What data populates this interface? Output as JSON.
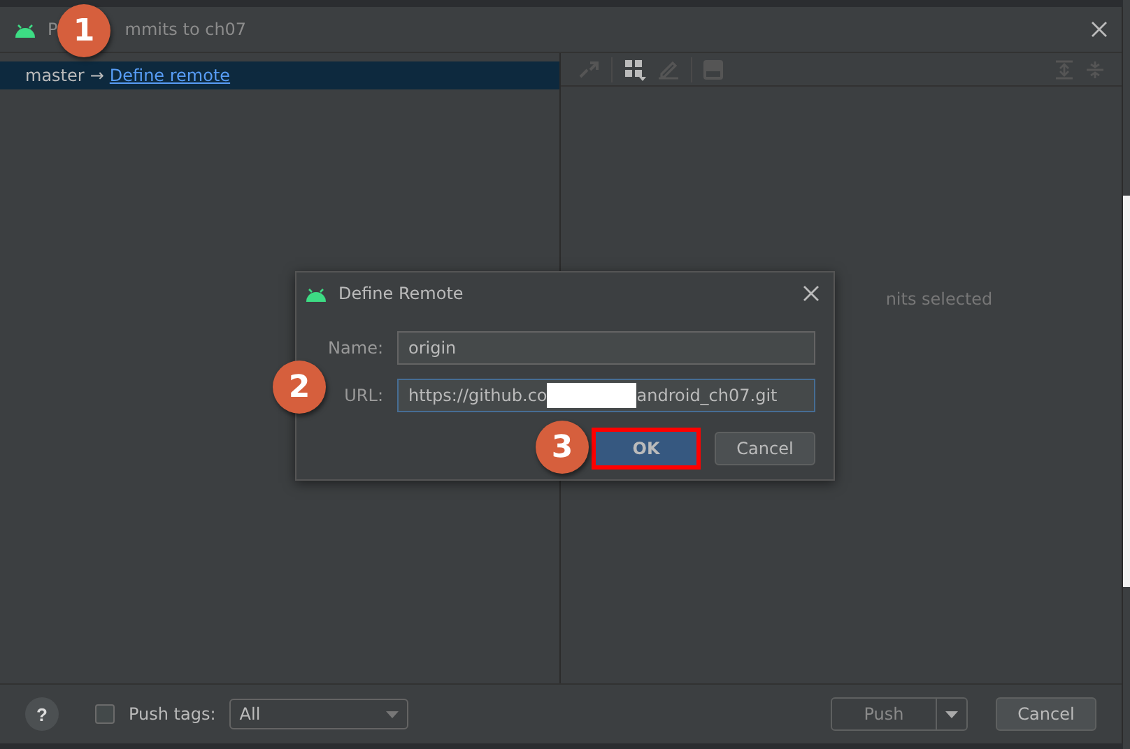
{
  "window": {
    "title_parts": [
      "P",
      "mmits to ch07"
    ]
  },
  "branch_row": {
    "branch": "master",
    "arrow": "→",
    "link": "Define remote",
    "selected": true
  },
  "details": {
    "empty_text": "nits selected"
  },
  "dialog": {
    "title": "Define Remote",
    "fields": [
      {
        "label": "Name:",
        "value": "origin",
        "focused": false
      },
      {
        "label": "URL:",
        "value_start": "https://github.co",
        "value_end": "android_ch07.git",
        "redacted": true,
        "focused": true
      }
    ],
    "buttons": [
      {
        "label": "OK",
        "kind": "primary",
        "highlighted": true
      },
      {
        "label": "Cancel",
        "kind": "secondary",
        "highlighted": false
      }
    ]
  },
  "callouts": [
    {
      "number": "1"
    },
    {
      "number": "2"
    },
    {
      "number": "3"
    }
  ],
  "footer": {
    "help": "?",
    "push_tags": {
      "label": "Push tags:",
      "checked": false,
      "value": "All"
    },
    "buttons": [
      {
        "label": "Push",
        "kind": "split",
        "disabled": true
      },
      {
        "label": "Cancel",
        "kind": "plain",
        "disabled": false
      }
    ]
  }
}
